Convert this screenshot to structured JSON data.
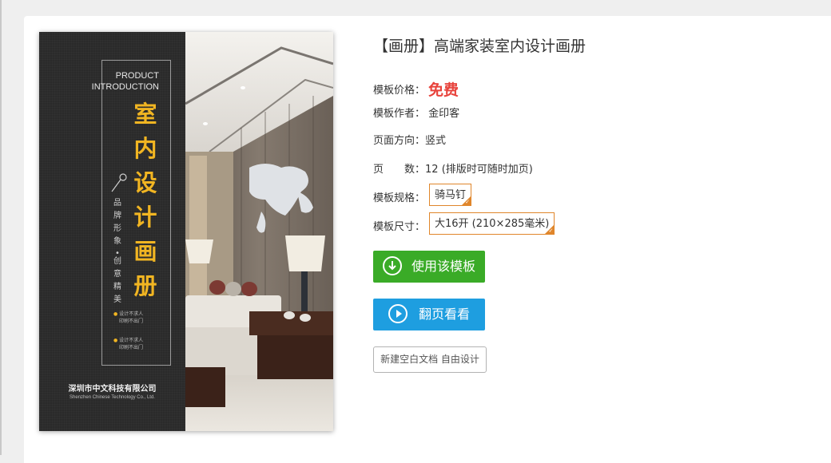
{
  "cover": {
    "product_line1": "PRODUCT",
    "product_line2": "INTRODUCTION",
    "title_chars": [
      "室",
      "内",
      "设",
      "计",
      "画",
      "册"
    ],
    "vertical_left": "品牌形象",
    "vertical_dot": "•",
    "vertical_right": "创意精美",
    "bullet1_line1": "设计不求人",
    "bullet1_line2": "印刷不出门",
    "bullet2_line1": "设计不求人",
    "bullet2_line2": "印刷不出门",
    "company": "深圳市中文科技有限公司",
    "company_en": "Shenzhen Chinese Technology Co., Ltd."
  },
  "info": {
    "title": "【画册】高端家装室内设计画册",
    "price_label": "模板价格：",
    "price_value": "免费",
    "author_label": "模板作者：",
    "author_value": "金印客",
    "orientation_label": "页面方向：",
    "orientation_value": "竖式",
    "pages_label": "页　　数：",
    "pages_value": "12 (排版时可随时加页)",
    "spec_label": "模板规格：",
    "spec_value": "骑马钉",
    "size_label": "模板尺寸：",
    "size_value": "大16开 (210×285毫米)"
  },
  "actions": {
    "use_template": "使用该模板",
    "flip_preview": "翻页看看",
    "new_blank": "新建空白文档 自由设计"
  },
  "colors": {
    "price": "#e8433c",
    "green_button": "#3aab27",
    "blue_button": "#1e9ee0",
    "chip_border": "#e0862b",
    "cover_gold": "#f1b522"
  },
  "icons": [
    "download-circle-icon",
    "play-circle-icon",
    "magnifier-icon",
    "check-icon"
  ]
}
